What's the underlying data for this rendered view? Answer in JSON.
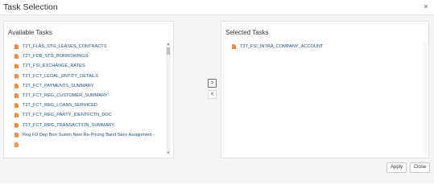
{
  "window": {
    "title": "Task Selection",
    "close_glyph": "×"
  },
  "available": {
    "title": "Available Tasks",
    "items": [
      "T2T_FLAS_STG_LEASES_CONTRACTS",
      "T2T_FDB_STG_BORROWINGS",
      "T2T_FSI_EXCHANGE_RATES",
      "T2T_FCT_LEGAL_ENTITY_DETAILS",
      "T2T_FCT_PAYMENTS_SUMMARY",
      "T2T_FCT_REG_CUSTOMER_SUMMARY",
      "T2T_FCT_REG_LOANS_SERVICED",
      "T2T_FCT_REG_PARTY_IDENTFCTN_DOC",
      "T2T_FCT_REG_TRANSACTION_SUMMARY",
      "Reg FD Dep Borr Summ Next Re-Pricing Band Skey Assignment -"
    ]
  },
  "selected": {
    "title": "Selected Tasks",
    "items": [
      "T2T_FSI_INTRA_COMPANY_ACCOUNT"
    ]
  },
  "controls": {
    "move_right_glyph": ">",
    "move_left_glyph": "<",
    "scroll_up_glyph": "▲",
    "scroll_down_glyph": "▼"
  },
  "buttons": {
    "apply": "Apply",
    "close": "Close"
  },
  "icons": {
    "task": "file-icon"
  },
  "colors": {
    "task_icon": "#f48a3c",
    "task_link": "#1e4e79"
  }
}
